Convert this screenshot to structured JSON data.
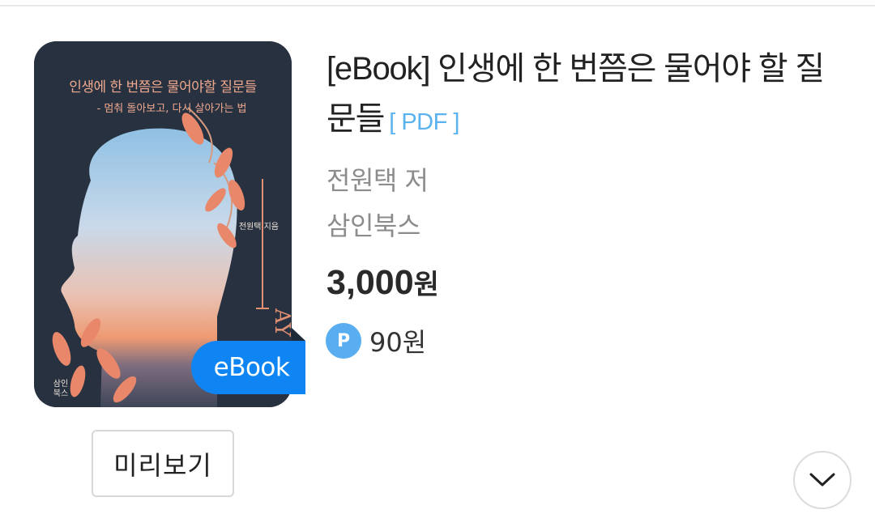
{
  "book": {
    "title": "[eBook] 인생에 한 번쯤은 물어야 할 질문들",
    "format": "[ PDF ]",
    "author": "전원택 저",
    "publisher": "삼인북스",
    "price": "3,000",
    "price_unit": "원",
    "points": "90원",
    "points_icon_label": "P"
  },
  "cover": {
    "title": "인생에 한 번쯤은 물어야할 질문들",
    "subtitle": "- 멈춰 돌아보고, 다시 살아가는 법",
    "author": "전원택 지음",
    "publisher_line1": "삼인",
    "publisher_line2": "북스",
    "badge": "eBook"
  },
  "actions": {
    "preview_label": "미리보기",
    "expand_icon": "chevron-down-icon"
  },
  "colors": {
    "badge": "#0f85f3",
    "format_tag": "#5ab3ee",
    "points_icon": "#58aef0",
    "muted_text": "#8c8c8c"
  }
}
